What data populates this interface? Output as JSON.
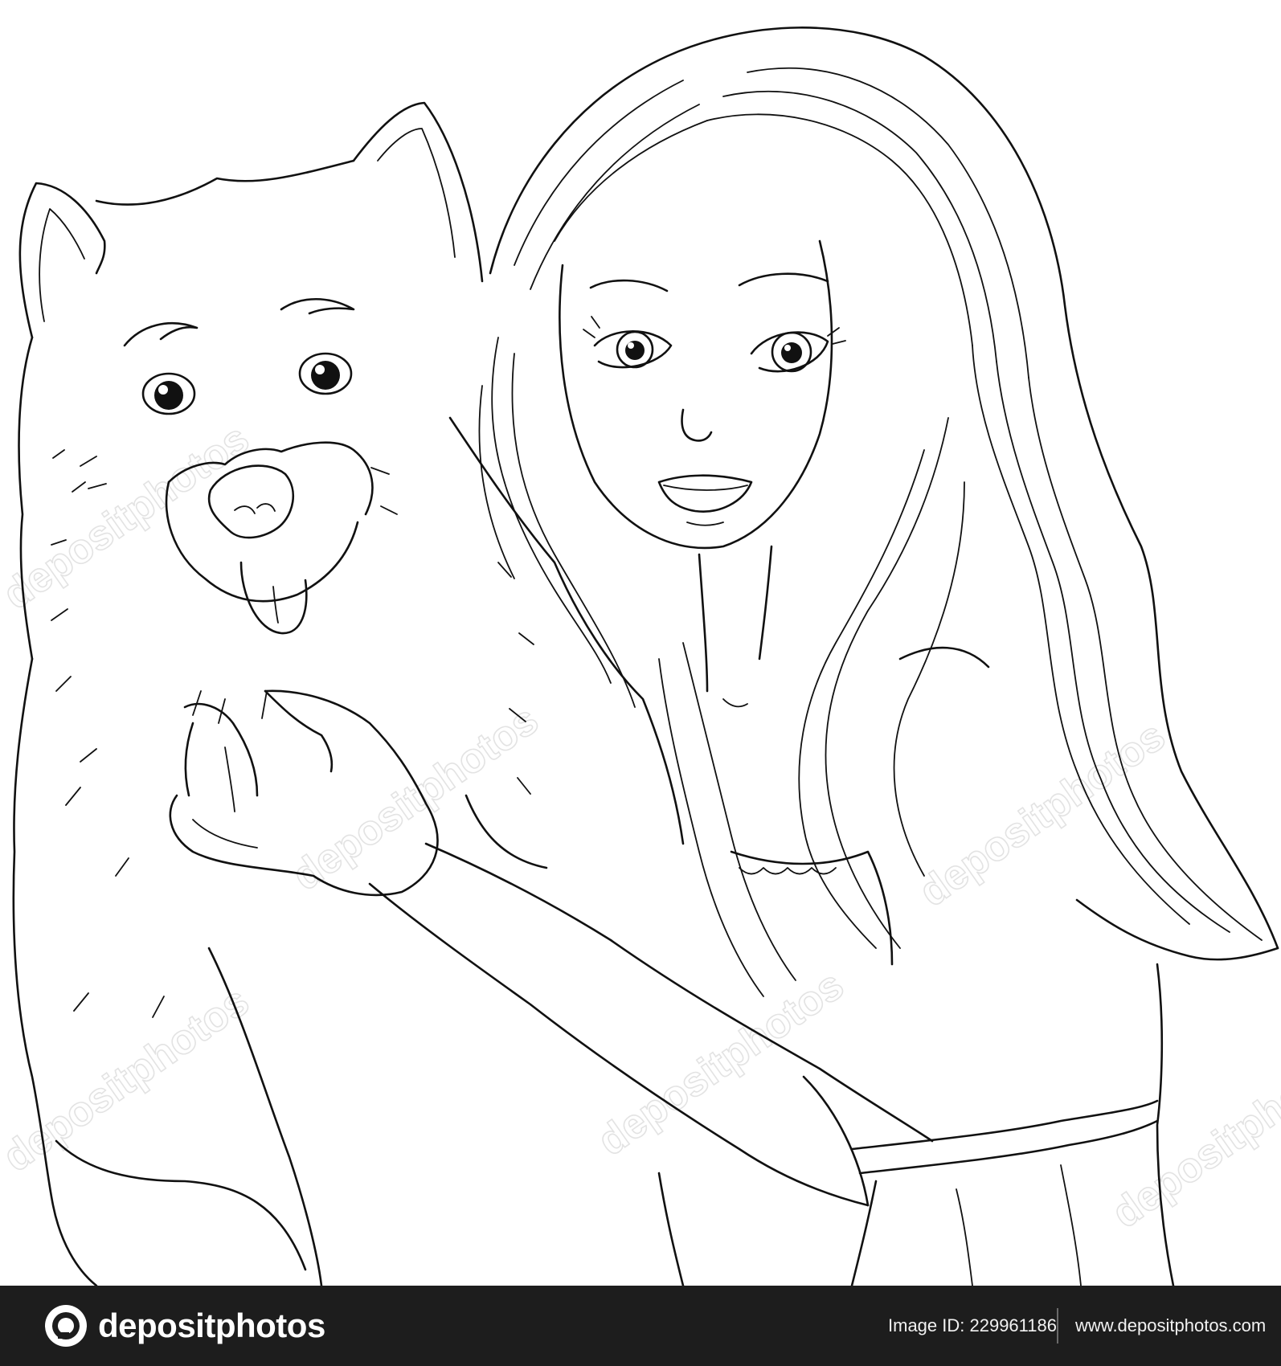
{
  "footer": {
    "brand": "depositphotos",
    "image_id": "Image ID: 229961186",
    "site_url": "www.depositphotos.com"
  },
  "watermark": {
    "text": "depositphotos"
  },
  "colors": {
    "footer_background": "#1d1d1d",
    "line_art": "#111111",
    "page_background": "#ffffff"
  },
  "icons": {
    "brand_logo": "depositphotos-logo-icon"
  }
}
